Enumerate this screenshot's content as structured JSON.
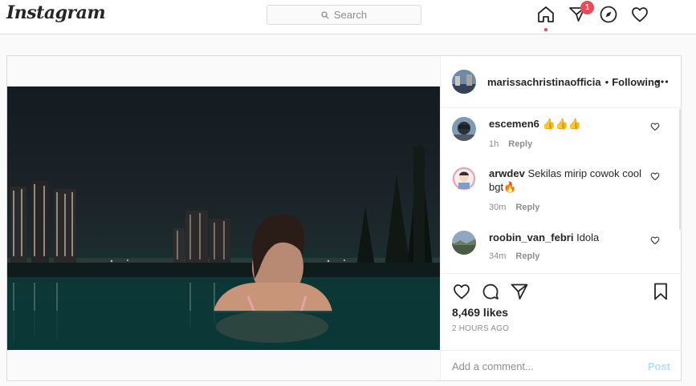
{
  "brand": {
    "logo": "Instagram"
  },
  "search": {
    "placeholder": "Search"
  },
  "nav": {
    "icons": [
      "home-icon",
      "direct-icon",
      "explore-icon",
      "activity-icon"
    ],
    "direct_badge": "1"
  },
  "post": {
    "owner": {
      "username": "marissachristinaofficia",
      "follow_state": "Following",
      "separator": "•"
    },
    "comments": [
      {
        "username": "escemen6",
        "text": "👍👍👍",
        "time": "1h",
        "reply": "Reply"
      },
      {
        "username": "arwdev",
        "text": "Sekilas mirip cowok cool bgt🔥",
        "time": "30m",
        "reply": "Reply"
      },
      {
        "username": "roobin_van_febri",
        "text": "Idola",
        "time": "34m",
        "reply": "Reply"
      }
    ],
    "likes": "8,469 likes",
    "timestamp": "2 HOURS AGO",
    "add_comment_placeholder": "Add a comment...",
    "post_button": "Post"
  }
}
